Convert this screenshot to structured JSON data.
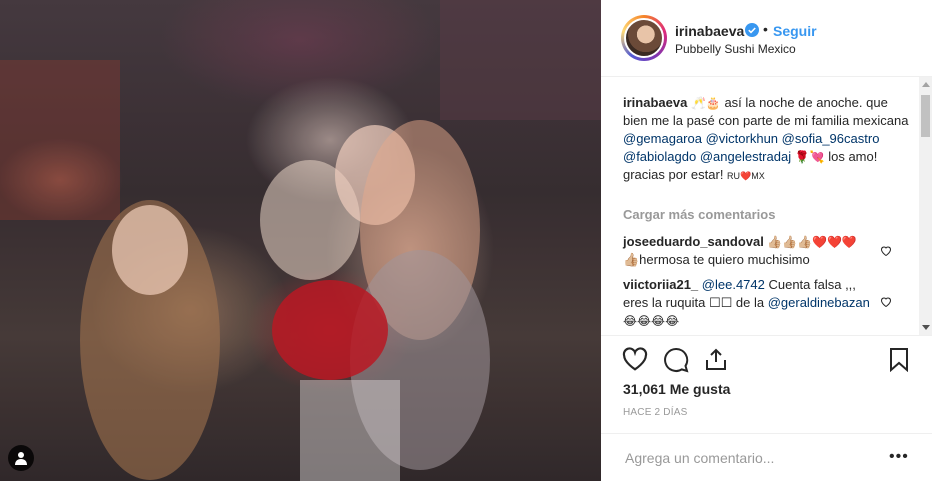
{
  "post": {
    "username": "irinabaeva",
    "verified_icon": "verified-badge-icon",
    "separator": "•",
    "follow_label": "Seguir",
    "location": "Pubbelly Sushi Mexico",
    "accent": "#3897f0"
  },
  "caption": {
    "username": "irinabaeva",
    "emoji_1": "🥂🎂",
    "text_1": " así la noche de anoche. que bien me la pasé con parte de mi familia mexicana ",
    "mention_1": "@gemagaroa",
    "mention_2": "@victorkhun",
    "mention_3": "@sofia_96castro",
    "mention_4": "@fabiolagdo",
    "mention_5": "@angelestradaj",
    "emoji_2": "🌹💘",
    "text_2": " los amo! gracias por estar! ",
    "emoji_3": "RU❤️MX"
  },
  "load_more_label": "Cargar más comentarios",
  "comments": [
    {
      "username": "joseeduardo_sandoval",
      "text_a": " 👍🏼👍🏼👍🏼❤️❤️❤️",
      "text_b": "👍🏼hermosa te quiero muchisimo"
    },
    {
      "username": "viictoriia21_",
      "mention": "@lee.4742",
      "text_a": " Cuenta falsa ,,, eres la ruquita ☐☐ de la ",
      "mention_2": "@geraldinebazan",
      "text_b": " 😂😂😂😂"
    }
  ],
  "actions": {
    "likes": "31,061 Me gusta",
    "time": "HACE 2 DÍAS"
  },
  "add_comment": {
    "placeholder": "Agrega un comentario...",
    "more_label": "•••"
  }
}
